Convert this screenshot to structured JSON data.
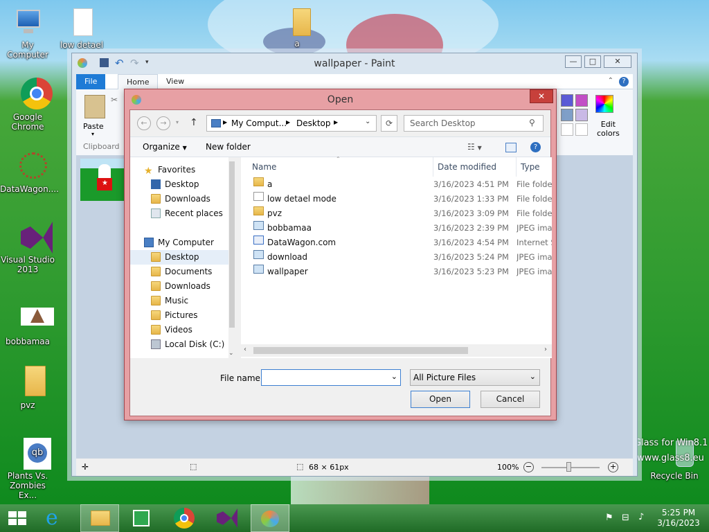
{
  "desktop": {
    "icons": [
      {
        "label": "My Computer"
      },
      {
        "label": "low detael"
      },
      {
        "label": "a"
      },
      {
        "label": "Google Chrome"
      },
      {
        "label": "DataWagon...."
      },
      {
        "label": "Visual Studio 2013"
      },
      {
        "label": "bobbamaa"
      },
      {
        "label": "pvz"
      },
      {
        "label": "Plants Vs. Zombies Ex..."
      },
      {
        "label": "Recycle Bin"
      }
    ],
    "watermark_line1": "Glass for Win8.1",
    "watermark_line2": "www.glass8.eu"
  },
  "paint": {
    "title": "wallpaper - Paint",
    "tabs": {
      "file": "File",
      "home": "Home",
      "view": "View"
    },
    "paste_label": "Paste",
    "clipboard_label": "Clipboard",
    "edit_colors_line1": "Edit",
    "edit_colors_line2": "colors",
    "status": {
      "size": "68 × 61px",
      "zoom": "100%"
    },
    "colors": {
      "accent": "#1e7bd6",
      "swatch1": "#5b5bd6",
      "swatch2": "#c24fc6",
      "swatch3": "#7f9fc8",
      "swatch4": "#c9b9e6"
    }
  },
  "dialog": {
    "title": "Open",
    "breadcrumb": {
      "root": "My Comput...",
      "current": "Desktop"
    },
    "search_placeholder": "Search Desktop",
    "organize": "Organize",
    "new_folder": "New folder",
    "nav": {
      "favorites": "Favorites",
      "fav_items": [
        "Desktop",
        "Downloads",
        "Recent places"
      ],
      "computer": "My Computer",
      "computer_items": [
        "Desktop",
        "Documents",
        "Downloads",
        "Music",
        "Pictures",
        "Videos",
        "Local Disk (C:)"
      ]
    },
    "columns": {
      "name": "Name",
      "date": "Date modified",
      "type": "Type"
    },
    "files": [
      {
        "name": "a",
        "date": "3/16/2023 4:51 PM",
        "type": "File folder",
        "icon": "folder-icon"
      },
      {
        "name": "low detael mode",
        "date": "3/16/2023 1:33 PM",
        "type": "File folder",
        "icon": "document-icon"
      },
      {
        "name": "pvz",
        "date": "3/16/2023 3:09 PM",
        "type": "File folder",
        "icon": "folder-icon"
      },
      {
        "name": "bobbamaa",
        "date": "3/16/2023 2:39 PM",
        "type": "JPEG image",
        "icon": "image-icon"
      },
      {
        "name": "DataWagon.com",
        "date": "3/16/2023 4:54 PM",
        "type": "Internet Shortcut",
        "icon": "shortcut-icon"
      },
      {
        "name": "download",
        "date": "3/16/2023 5:24 PM",
        "type": "JPEG image",
        "icon": "image-icon"
      },
      {
        "name": "wallpaper",
        "date": "3/16/2023 5:23 PM",
        "type": "JPEG image",
        "icon": "image-icon"
      }
    ],
    "filename_label": "File name:",
    "filename_value": "",
    "filter": "All Picture Files",
    "open_button": "Open",
    "cancel_button": "Cancel"
  },
  "taskbar": {
    "time": "5:25 PM",
    "date": "3/16/2023"
  }
}
